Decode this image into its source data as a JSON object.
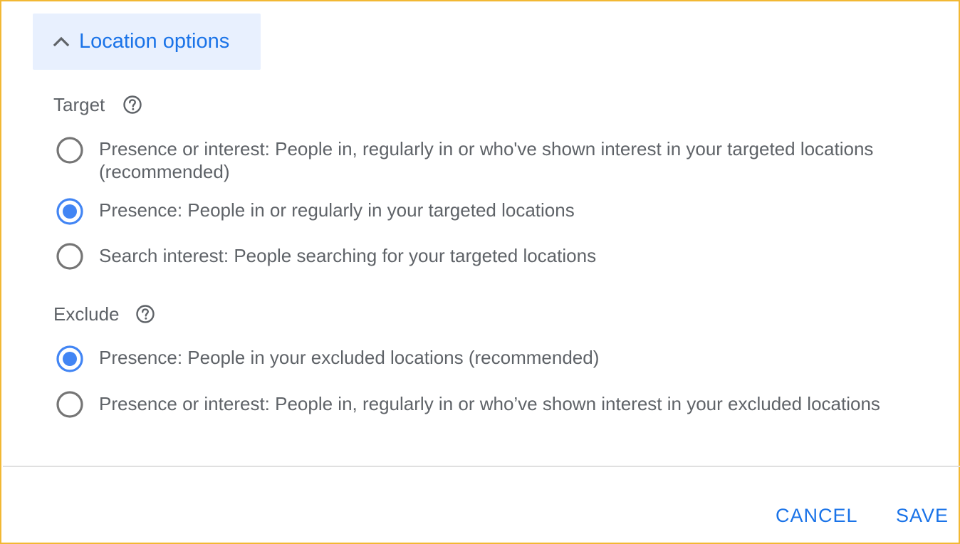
{
  "section": {
    "title": "Location options",
    "expanded": true
  },
  "target": {
    "label": "Target",
    "options": [
      {
        "label": "Presence or interest: People in, regularly in or who've shown interest in your targeted locations (recommended)",
        "selected": false
      },
      {
        "label": "Presence: People in or regularly in your targeted locations",
        "selected": true
      },
      {
        "label": "Search interest: People searching for your targeted locations",
        "selected": false
      }
    ]
  },
  "exclude": {
    "label": "Exclude",
    "options": [
      {
        "label": "Presence: People in your excluded locations (recommended)",
        "selected": true
      },
      {
        "label": "Presence or interest: People in, regularly in or who’ve shown interest in your excluded locations",
        "selected": false
      }
    ]
  },
  "actions": {
    "cancel": "CANCEL",
    "save": "SAVE"
  },
  "icons": {
    "chevron": "chevron-up-icon",
    "help": "help-circle-icon"
  },
  "colors": {
    "accent": "#1a73e8",
    "radio_selected": "#4285f4",
    "radio_unselected": "#757575",
    "text": "#5f6368",
    "toggle_bg": "#e8f0fe",
    "frame_border": "#f2b833"
  }
}
